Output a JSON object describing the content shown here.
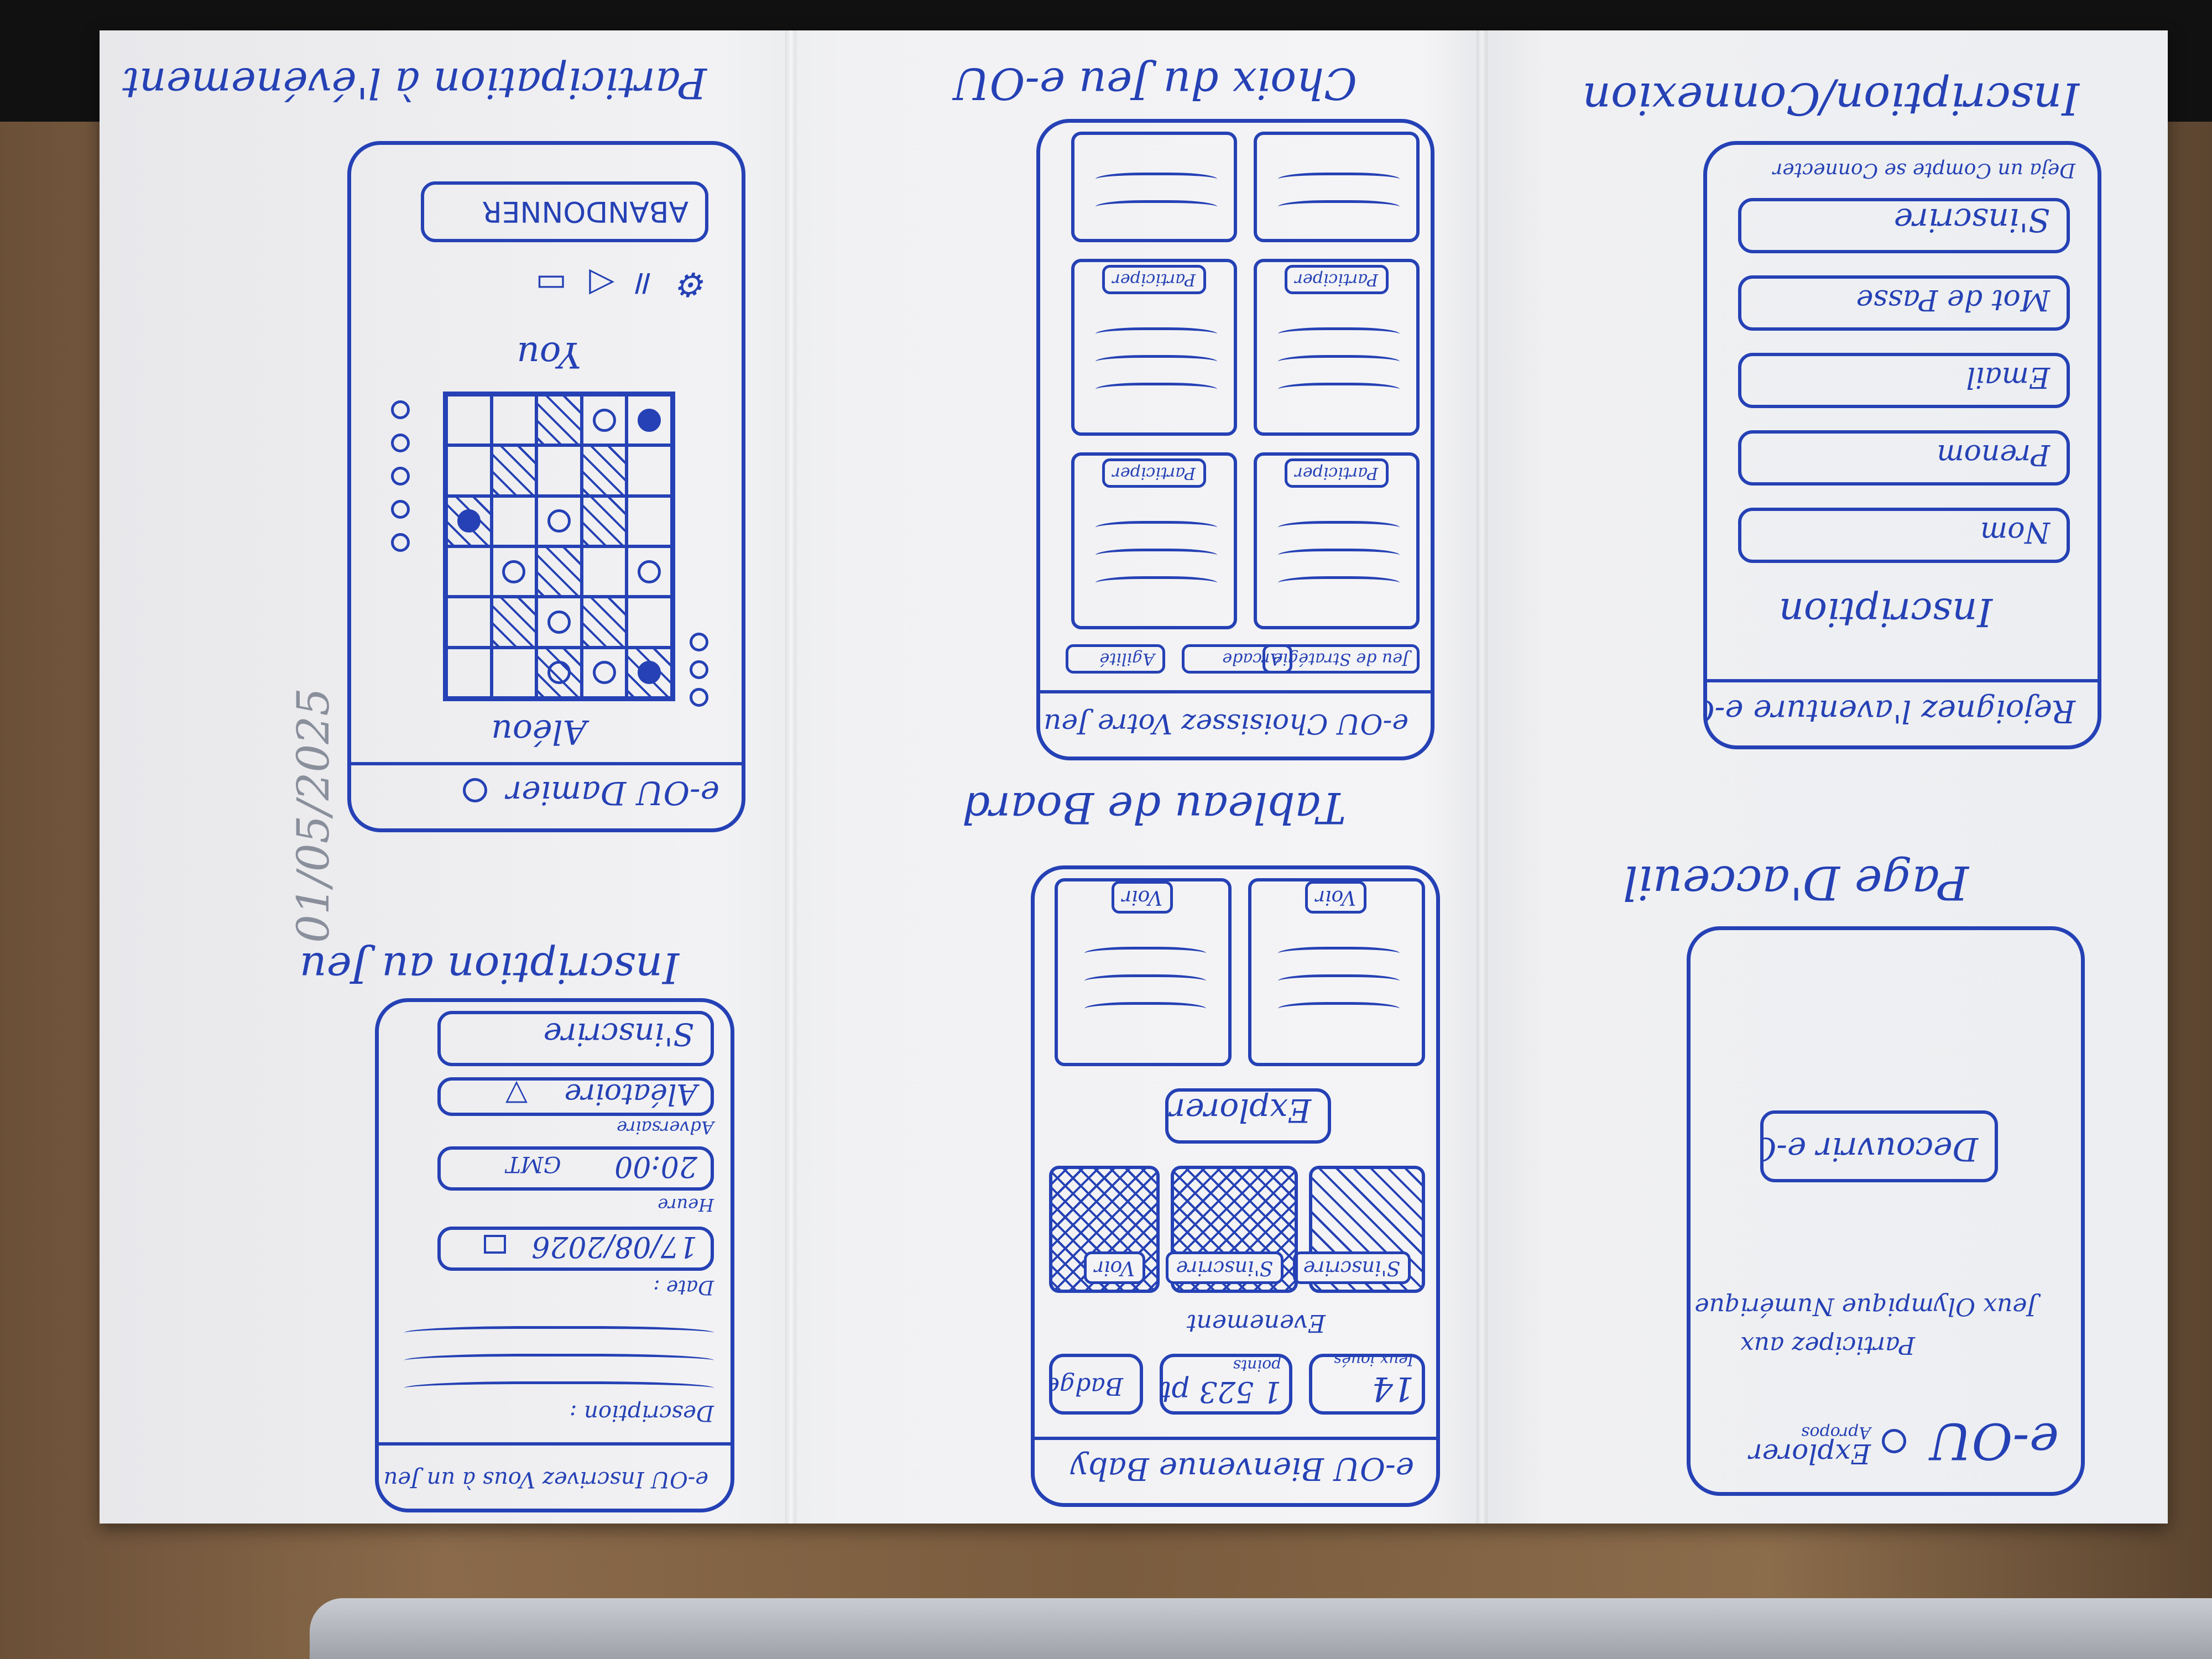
{
  "colors": {
    "ink": "#2541b5",
    "paper": "#f2f2f4",
    "desk": "#7a5c3e"
  },
  "screen_welcome": {
    "caption": "Page D'acceuil",
    "logo": "e-OU",
    "header_links": [
      "Explorer",
      "Apropos"
    ],
    "tagline_1": "Participez aux",
    "tagline_2": "Jeux Olympique Numérique",
    "cta": "Decouvrir e-OU"
  },
  "screen_signup": {
    "caption": "Inscription/Connexion",
    "header": "Rejoignez l'aventure e-OU",
    "title": "Inscription",
    "fields": [
      "Nom",
      "Prenom",
      "Email",
      "Mot de Passe"
    ],
    "submit": "S'inscrire",
    "login_link": "Deja un Compte se Connecter"
  },
  "screen_dashboard": {
    "caption": "Tableau de Board",
    "header": "e-OU Bienvenue Baby",
    "stats": [
      {
        "value": "14",
        "label": "Jeux joués"
      },
      {
        "value": "1 523 pts",
        "label": "points"
      },
      {
        "value": "Badge",
        "label": ""
      }
    ],
    "events_title": "Evenement",
    "event_tags": [
      "S'inscrire",
      "S'inscrire",
      "Voir"
    ],
    "explore": "Explorer",
    "card_buttons": [
      "Voir",
      "Voir"
    ]
  },
  "screen_choice": {
    "caption": "Choix du Jeu e-OU",
    "header": "e-OU Choisissez Votre Jeu",
    "filters": [
      "Jeu de Stratégie",
      "Arcade",
      "Agilité"
    ],
    "participate": [
      "Participer",
      "Participer",
      "Participer",
      "Participer"
    ]
  },
  "screen_tournament": {
    "caption": "Inscription au Jeu",
    "header": "e-OU Inscrivez Vous à un Jeu",
    "description_label": "Description :",
    "date_label": "Date :",
    "date_value": "17/08/2026",
    "time_label": "Heure",
    "time_value": "20:00",
    "timezone": "GMT",
    "opponent_label": "Adversaire",
    "opponent_value": "Aléatoire",
    "submit": "S'inscrire"
  },
  "screen_game": {
    "caption": "Participation à l'événement",
    "header": "e-OU Damier",
    "opponent": "Aléou",
    "player": "You",
    "quit": "ABANDONNER"
  },
  "margin_note": "01/05/2025"
}
